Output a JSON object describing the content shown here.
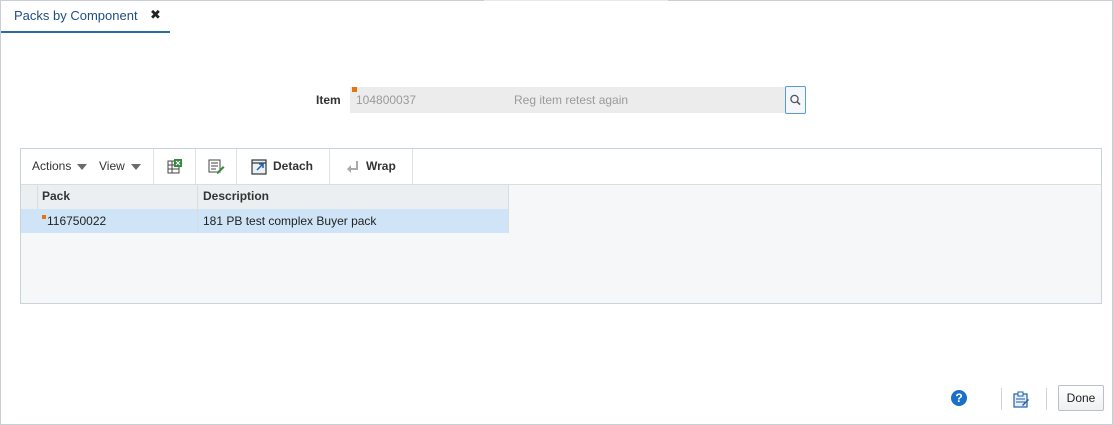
{
  "tab": {
    "title": "Packs by Component",
    "close_glyph": "✖"
  },
  "item": {
    "label": "Item",
    "value": "104800037",
    "description": "Reg item retest again"
  },
  "toolbar": {
    "actions_label": "Actions",
    "view_label": "View",
    "detach_label": "Detach",
    "wrap_label": "Wrap"
  },
  "table": {
    "columns": [
      "Pack",
      "Description"
    ],
    "rows": [
      {
        "pack": "116750022",
        "description": "181 PB test complex Buyer pack"
      }
    ]
  },
  "footer": {
    "help_glyph": "?",
    "done_label": "Done"
  },
  "colors": {
    "accent": "#2b6aa5",
    "selected_row": "#cfe5f7",
    "required_marker": "#e8740c"
  }
}
